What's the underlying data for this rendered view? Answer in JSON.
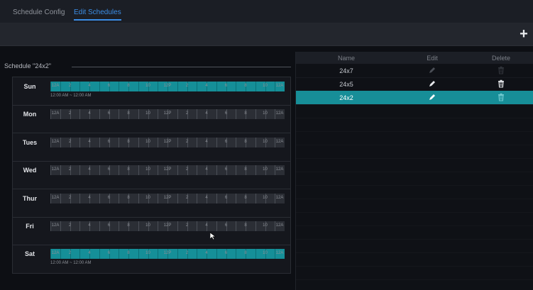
{
  "tabs": [
    {
      "label": "Schedule Config",
      "active": false
    },
    {
      "label": "Edit Schedules",
      "active": true
    }
  ],
  "toolbar": {
    "add_icon": "plus-icon"
  },
  "schedule": {
    "title": "Schedule \"24x2\"",
    "tick_labels": [
      "12A",
      "2",
      "4",
      "6",
      "8",
      "10",
      "12P",
      "2",
      "4",
      "6",
      "8",
      "10",
      "12A"
    ],
    "days": [
      {
        "name": "Sun",
        "active": true,
        "range": "12:00 AM ~ 12:00 AM"
      },
      {
        "name": "Mon",
        "active": false,
        "range": ""
      },
      {
        "name": "Tues",
        "active": false,
        "range": ""
      },
      {
        "name": "Wed",
        "active": false,
        "range": ""
      },
      {
        "name": "Thur",
        "active": false,
        "range": ""
      },
      {
        "name": "Fri",
        "active": false,
        "range": ""
      },
      {
        "name": "Sat",
        "active": true,
        "range": "12:00 AM ~ 12:00 AM"
      }
    ]
  },
  "list": {
    "headers": {
      "name": "Name",
      "edit": "Edit",
      "delete": "Delete"
    },
    "rows": [
      {
        "name": "24x7",
        "selected": false,
        "editable": false,
        "deletable": false
      },
      {
        "name": "24x5",
        "selected": false,
        "editable": true,
        "deletable": true
      },
      {
        "name": "24x2",
        "selected": true,
        "editable": true,
        "deletable": true
      }
    ]
  },
  "colors": {
    "accent": "#178e98",
    "tab_active": "#3b8ee6",
    "segment_on": "#158f98",
    "segment_off": "#2b2e35"
  }
}
